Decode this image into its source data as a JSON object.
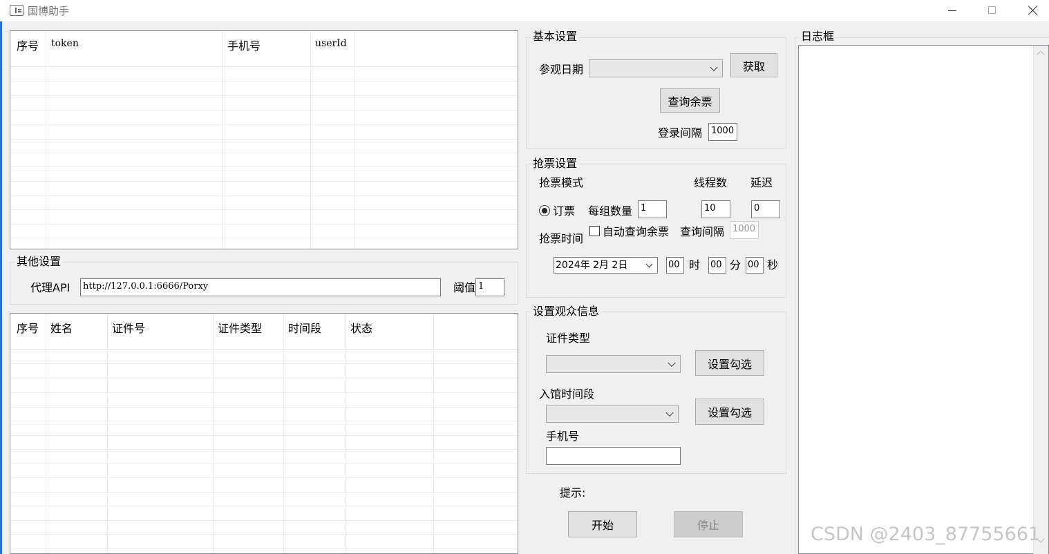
{
  "window": {
    "title": "国博助手"
  },
  "account_table": {
    "columns": [
      "序号",
      "token",
      "手机号",
      "userId"
    ],
    "rows": []
  },
  "other_settings": {
    "title": "其他设置",
    "proxy_label": "代理API",
    "proxy_value": "http://127.0.0.1:6666/Porxy",
    "threshold_label": "阈值",
    "threshold_value": "1"
  },
  "audience_table": {
    "columns": [
      "序号",
      "姓名",
      "证件号",
      "证件类型",
      "时间段",
      "状态"
    ],
    "rows": []
  },
  "basic_settings": {
    "title": "基本设置",
    "visit_date_label": "参观日期",
    "visit_date_value": "",
    "fetch_button": "获取",
    "query_remaining_button": "查询余票",
    "login_interval_label": "登录间隔",
    "login_interval_value": "1000"
  },
  "grab_settings": {
    "title": "抢票设置",
    "mode_label": "抢票模式",
    "threads_label": "线程数",
    "delay_label": "延迟",
    "order_radio_label": "订票",
    "order_radio_checked": true,
    "group_count_label": "每组数量",
    "group_count_value": "1",
    "threads_value": "10",
    "delay_value": "0",
    "grab_time_label": "抢票时间",
    "auto_query_label": "自动查询余票",
    "auto_query_checked": false,
    "query_interval_label": "查询间隔",
    "query_interval_value": "1000",
    "date_value": "2024年  2月  2日",
    "hour_value": "00",
    "hour_unit": "时",
    "minute_value": "00",
    "minute_unit": "分",
    "second_value": "00",
    "second_unit": "秒"
  },
  "audience_settings": {
    "title": "设置观众信息",
    "id_type_label": "证件类型",
    "id_type_value": "",
    "set_check_button_1": "设置勾选",
    "time_slot_label": "入馆时间段",
    "time_slot_value": "",
    "set_check_button_2": "设置勾选",
    "phone_label": "手机号",
    "phone_value": ""
  },
  "hint_label": "提示:",
  "start_button": "开始",
  "stop_button": "停止",
  "log": {
    "title": "日志框",
    "content": ""
  },
  "watermark": "CSDN @2403_87755661"
}
